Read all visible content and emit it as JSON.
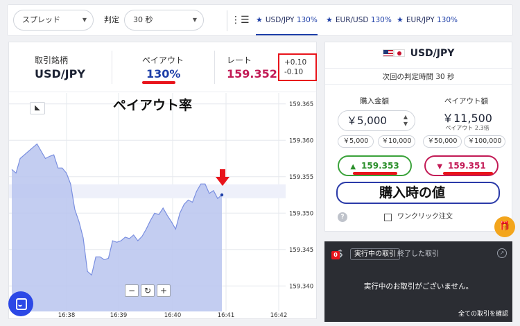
{
  "toolbar": {
    "spread_select": "スプレッド",
    "judge_label": "判定",
    "judge_select": "30 秒",
    "tabs": [
      {
        "pair": "USD/JPY",
        "pct": "130%"
      },
      {
        "pair": "EUR/USD",
        "pct": "130%"
      },
      {
        "pair": "EUR/JPY",
        "pct": "130%"
      }
    ]
  },
  "info": {
    "symbol_label": "取引銘柄",
    "symbol": "USD/JPY",
    "payout_label": "ペイアウト",
    "payout": "130%",
    "rate_label": "レート",
    "rate": "159.352",
    "diff_up": "+0.10",
    "diff_down": "-0.10"
  },
  "annotations": {
    "payout_rate": "ペイアウト率",
    "purchase_value": "購入時の値"
  },
  "zoom": {
    "minus": "−",
    "reset": "↻",
    "plus": "+"
  },
  "chart_data": {
    "type": "area",
    "x_ticks": [
      "16:38",
      "16:39",
      "16:40",
      "16:41",
      "16:42"
    ],
    "y_ticks": [
      "159.365",
      "159.360",
      "159.355",
      "159.350",
      "159.345",
      "159.340"
    ],
    "ylim": [
      159.3365,
      159.3665
    ],
    "y": [
      159.356,
      159.3555,
      159.3575,
      159.358,
      159.3585,
      159.359,
      159.3595,
      159.3585,
      159.3575,
      159.3578,
      159.358,
      159.3562,
      159.3562,
      159.3555,
      159.354,
      159.3505,
      159.3488,
      159.3466,
      159.342,
      159.3415,
      159.344,
      159.344,
      159.3436,
      159.3438,
      159.3462,
      159.346,
      159.3462,
      159.3467,
      159.3465,
      159.347,
      159.3462,
      159.3468,
      159.3478,
      159.349,
      159.35,
      159.3498,
      159.3507,
      159.3497,
      159.3488,
      159.3478,
      159.35,
      159.3512,
      159.3518,
      159.3515,
      159.353,
      159.354,
      159.354,
      159.3527,
      159.3531,
      159.352,
      159.3525
    ],
    "purchase_level": 159.353,
    "grid": true,
    "color": "#7a8fe0"
  },
  "trade": {
    "pair": "USD/JPY",
    "next_time": "次回の判定時間 30 秒",
    "amount_label": "購入金額",
    "payout_label": "ペイアウト額",
    "amount": "￥5,000",
    "payout_amount": "￥11,500",
    "payout_rate": "ペイアウト 2.3倍",
    "chips": [
      "￥5,000",
      "￥10,000",
      "￥50,000",
      "￥100,000"
    ],
    "high": "159.353",
    "low": "159.351",
    "oneclick": "ワンクリック注文"
  },
  "positions": {
    "badge": "0",
    "tab_active": "実行中の取引",
    "tab_done": "終了した取引",
    "empty": "実行中のお取引がございません。",
    "all": "全ての取引を確認"
  },
  "colors": {
    "accent": "#1e3fa8",
    "red": "#e8141b",
    "green": "#3aa23a",
    "rose": "#c21a55",
    "dark": "#2b2d33"
  }
}
